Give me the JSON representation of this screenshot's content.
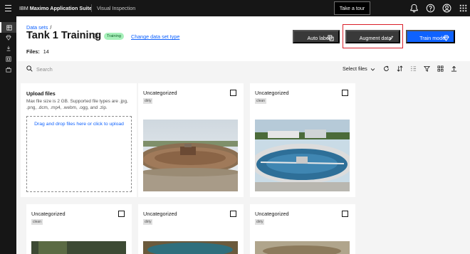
{
  "header": {
    "brand_prefix": "IBM",
    "brand_name": "Maximo Application Suite",
    "product": "Visual Inspection",
    "tour_button": "Take a tour",
    "icons": [
      "notification-icon",
      "help-icon",
      "user-avatar-icon",
      "app-switcher-icon"
    ]
  },
  "siderail": {
    "items": [
      {
        "icon": "datasets-icon",
        "active": true
      },
      {
        "icon": "models-icon",
        "active": false
      },
      {
        "icon": "deploy-icon",
        "active": false
      },
      {
        "icon": "projects-icon",
        "active": false
      },
      {
        "icon": "edge-icon",
        "active": false
      }
    ]
  },
  "breadcrumb": {
    "link": "Data sets",
    "separator": "/"
  },
  "page": {
    "title": "Tank 1 Training",
    "status_tag": "Training",
    "change_link": "Change data set type",
    "files_label": "Files:",
    "files_count": "14"
  },
  "actions": {
    "auto_label": "Auto label",
    "augment": "Augment data",
    "train": "Train model"
  },
  "toolbar": {
    "search_placeholder": "Search",
    "select_files": "Select files",
    "icons": [
      "refresh-icon",
      "sort-icon",
      "group-icon",
      "filter-icon",
      "grid-view-icon",
      "upload-icon"
    ]
  },
  "upload": {
    "title": "Upload files",
    "description": "Max file size is 2 GB. Supported file types are .jpg, .png, .dcm, .mp4, .webm, .ogg, and .zip.",
    "dropzone": "Drag and drop files here or click to upload"
  },
  "cards": [
    {
      "title": "Uncategorized",
      "tag": "dirty",
      "image": "dirty-clarifier-tank"
    },
    {
      "title": "Uncategorized",
      "tag": "clean",
      "image": "clean-clarifier-tank"
    },
    {
      "title": "Uncategorized",
      "tag": "clean",
      "image": "tank-photo"
    },
    {
      "title": "Uncategorized",
      "tag": "dirty",
      "image": "tank-photo"
    },
    {
      "title": "Uncategorized",
      "tag": "dirty",
      "image": "tank-photo"
    }
  ],
  "colors": {
    "header_bg": "#161616",
    "primary": "#0f62fe",
    "secondary_btn": "#393939",
    "highlight": "#da1e28",
    "tag_green": "#a7f0ba"
  }
}
